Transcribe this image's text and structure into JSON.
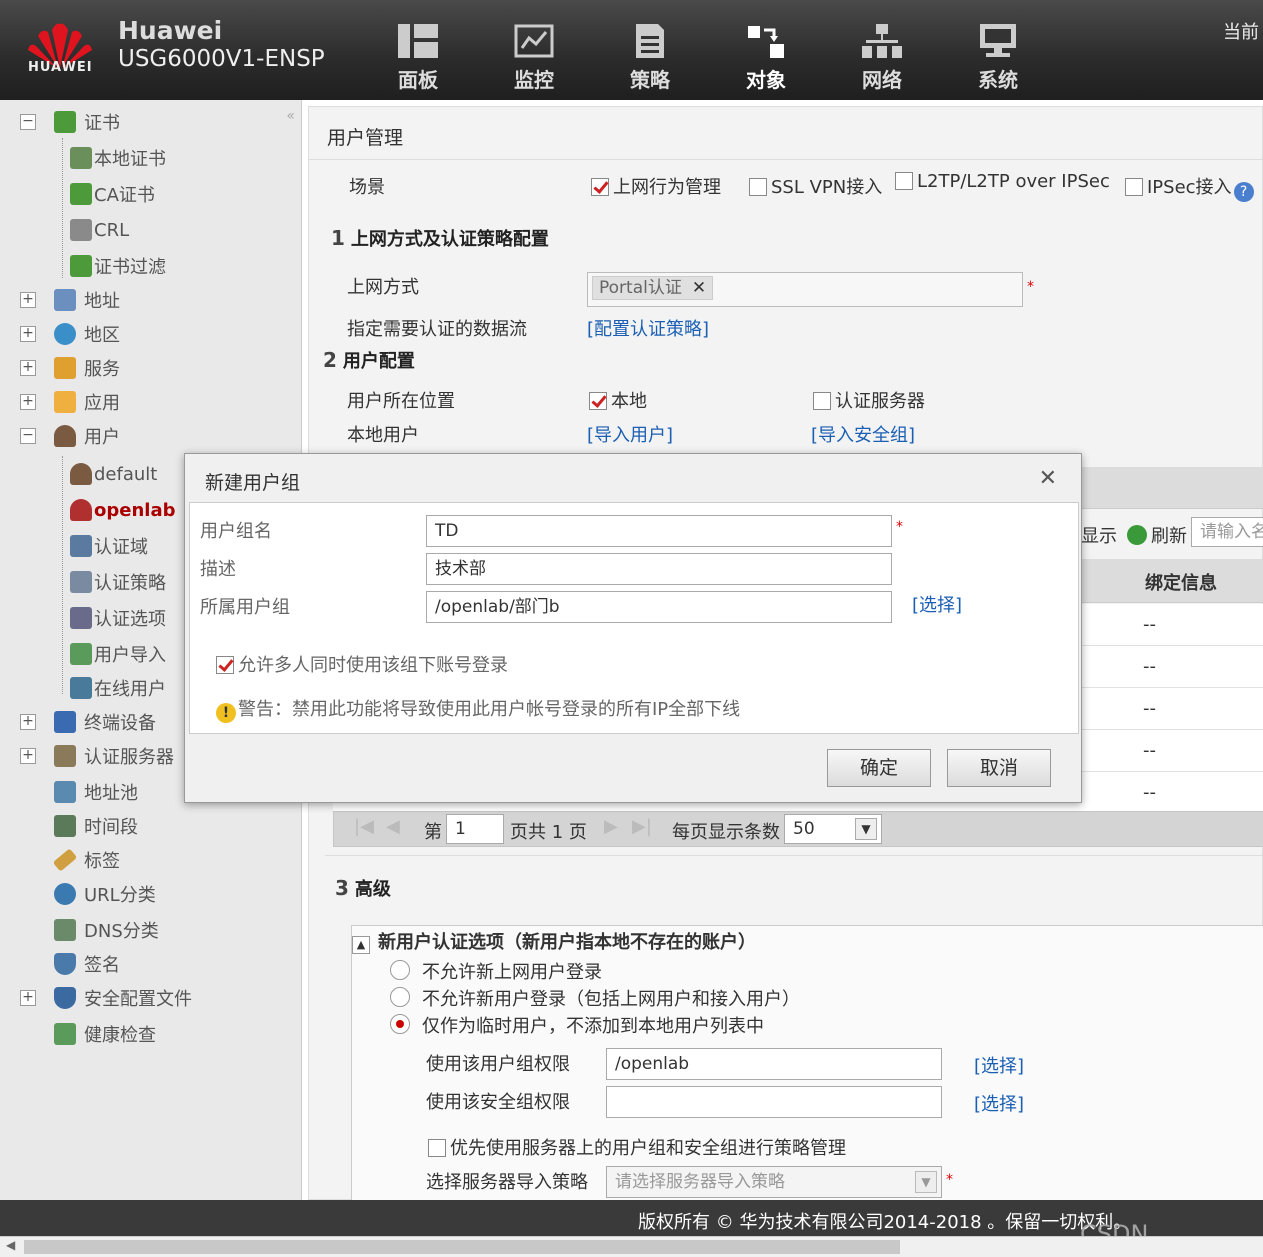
{
  "header": {
    "logo_text": "HUAWEI",
    "brand": "Huawei",
    "model": "USG6000V1-ENSP",
    "corner_text": "当前",
    "nav": [
      {
        "label": "面板",
        "icon": "dashboard-icon"
      },
      {
        "label": "监控",
        "icon": "monitor-icon"
      },
      {
        "label": "策略",
        "icon": "policy-icon"
      },
      {
        "label": "对象",
        "icon": "object-icon"
      },
      {
        "label": "网络",
        "icon": "network-icon"
      },
      {
        "label": "系统",
        "icon": "system-icon"
      }
    ]
  },
  "sidebar": {
    "items": [
      {
        "label": "证书",
        "expander": "−"
      },
      {
        "label": "本地证书"
      },
      {
        "label": "CA证书"
      },
      {
        "label": "CRL"
      },
      {
        "label": "证书过滤"
      },
      {
        "label": "地址",
        "expander": "+"
      },
      {
        "label": "地区",
        "expander": "+"
      },
      {
        "label": "服务",
        "expander": "+"
      },
      {
        "label": "应用",
        "expander": "+"
      },
      {
        "label": "用户",
        "expander": "−"
      },
      {
        "label": "default"
      },
      {
        "label": "openlab"
      },
      {
        "label": "认证域"
      },
      {
        "label": "认证策略"
      },
      {
        "label": "认证选项"
      },
      {
        "label": "用户导入"
      },
      {
        "label": "在线用户"
      },
      {
        "label": "终端设备",
        "expander": "+"
      },
      {
        "label": "认证服务器",
        "expander": "+"
      },
      {
        "label": "地址池"
      },
      {
        "label": "时间段"
      },
      {
        "label": "标签"
      },
      {
        "label": "URL分类"
      },
      {
        "label": "DNS分类"
      },
      {
        "label": "签名"
      },
      {
        "label": "安全配置文件",
        "expander": "+"
      },
      {
        "label": "健康检查"
      }
    ]
  },
  "main": {
    "title": "用户管理",
    "scene_label": "场景",
    "scene_options": [
      "上网行为管理",
      "SSL VPN接入",
      "L2TP/L2TP over IPSec",
      "IPSec接入"
    ],
    "sec1": {
      "num": "1",
      "title": "上网方式及认证策略配置"
    },
    "access_label": "上网方式",
    "access_tag": "Portal认证",
    "flow_label": "指定需要认证的数据流",
    "flow_link": "[配置认证策略]",
    "sec2": {
      "num": "2",
      "title": "用户配置"
    },
    "location_label": "用户所在位置",
    "location_local": "本地",
    "location_server": "认证服务器",
    "local_user_label": "本地用户",
    "import_user_link": "[导入用户]",
    "import_group_link": "[导入安全组]",
    "grid_show": "显示",
    "grid_refresh": "刷新",
    "grid_search_placeholder": "请输入名",
    "grid_col_bind": "绑定信息",
    "grid_rows": [
      "--",
      "--",
      "--",
      "--",
      "--"
    ],
    "pager": {
      "di": "第",
      "page": "1",
      "total": "页共 1 页",
      "per_page_label": "每页显示条数",
      "per_page": "50"
    },
    "sec3": {
      "num": "3",
      "title": "高级"
    },
    "new_user_title": "新用户认证选项（新用户指本地不存在的账户）",
    "radio_options": [
      "不允许新上网用户登录",
      "不允许新用户登录（包括上网用户和接入用户）",
      "仅作为临时用户，不添加到本地用户列表中"
    ],
    "group_perm_label": "使用该用户组权限",
    "group_perm_value": "/openlab",
    "sec_perm_label": "使用该安全组权限",
    "select_link": "[选择]",
    "prefer_server_label": "优先使用服务器上的用户组和安全组进行策略管理",
    "import_policy_label": "选择服务器导入策略",
    "import_policy_placeholder": "请选择服务器导入策略"
  },
  "dialog": {
    "title": "新建用户组",
    "name_label": "用户组名",
    "name_value": "TD",
    "desc_label": "描述",
    "desc_value": "技术部",
    "parent_label": "所属用户组",
    "parent_value": "/openlab/部门b",
    "select_link": "[选择]",
    "allow_multi": "允许多人同时使用该组下账号登录",
    "warning": "警告：禁用此功能将导致使用此用户帐号登录的所有IP全部下线",
    "ok": "确定",
    "cancel": "取消"
  },
  "footer": {
    "copyright": "版权所有 © 华为技术有限公司2014-2018 。保留一切权利。"
  },
  "watermark": "CSDN @quencep",
  "colors": {
    "accent_red": "#c22222",
    "link_blue": "#1a5fb4",
    "header_bg": "#2b2b2b"
  }
}
